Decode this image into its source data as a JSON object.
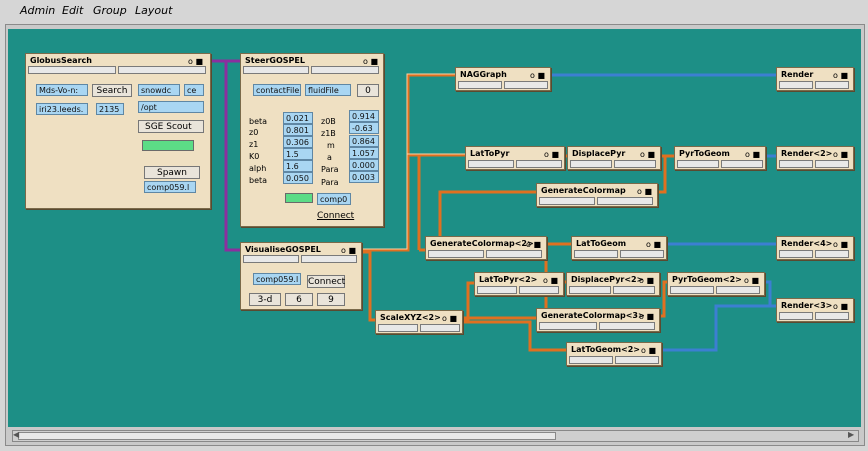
{
  "menu": [
    "Admin",
    "Edit",
    "Group",
    "Layout"
  ],
  "colors": {
    "canvas": "#1d8f86",
    "module": "#efe0c2",
    "orange": "#e07020",
    "blue": "#3c7fd2",
    "purple": "#8b2f9f",
    "green": "#5cdc86"
  },
  "modules": {
    "globus": {
      "title": "GlobusSearch",
      "ctrl": "o ■",
      "host1": "Mds-Vo-n:",
      "search": "Search",
      "host2": "iri23.leeds.",
      "port": "2135",
      "user": "snowdc",
      "ce": "ce",
      "path": "/opt",
      "scheduler": "SGE Scout",
      "spawn": "Spawn",
      "machine": "comp059.l"
    },
    "steer": {
      "title": "SteerGOSPEL",
      "ctrl": "o ■",
      "file1": "contactFile",
      "file2": "fluidFile",
      "count": "0",
      "left": [
        {
          "name": "beta",
          "value": "0.021"
        },
        {
          "name": "z0",
          "value": "0.801"
        },
        {
          "name": "z1",
          "value": "0.306"
        },
        {
          "name": "K0",
          "value": "1.5"
        },
        {
          "name": "alph",
          "value": "1.6"
        },
        {
          "name": "beta",
          "value": "0.050"
        }
      ],
      "right": [
        {
          "name": "z0B",
          "value": "0.914"
        },
        {
          "name": "z1B",
          "value": "-0.63"
        },
        {
          "name": "m",
          "value": "0.864"
        },
        {
          "name": "a",
          "value": "1.057"
        },
        {
          "name": "Para",
          "value": "0.000"
        },
        {
          "name": "Para",
          "value": "0.003"
        }
      ],
      "machine": "comp0",
      "connect": "Connect"
    },
    "vis": {
      "title": "VisualiseGOSPEL",
      "ctrl": "o ■",
      "machine": "comp059.l",
      "connect": "Connect",
      "mode": "3-d",
      "v1": "6",
      "v2": "9"
    },
    "nag": {
      "title": "NAGGraph",
      "ctrl": "o ■"
    },
    "render1": {
      "title": "Render",
      "ctrl": "o ■"
    },
    "lat1": {
      "title": "LatToPyr",
      "ctrl": "o ■"
    },
    "disp1": {
      "title": "DisplacePyr",
      "ctrl": "o ■"
    },
    "pyr1": {
      "title": "PyrToGeom",
      "ctrl": "o ■"
    },
    "render2": {
      "title": "Render<2>",
      "ctrl": "o ■"
    },
    "gencol": {
      "title": "GenerateColormap",
      "ctrl": "o ■"
    },
    "gencol2": {
      "title": "GenerateColormap<2>",
      "ctrl": "o ■"
    },
    "latgeom": {
      "title": "LatToGeom",
      "ctrl": "o ■"
    },
    "render4": {
      "title": "Render<4>",
      "ctrl": "o ■"
    },
    "lat2": {
      "title": "LatToPyr<2>",
      "ctrl": "o ■"
    },
    "disp2": {
      "title": "DisplacePyr<2>",
      "ctrl": "o ■"
    },
    "pyr2": {
      "title": "PyrToGeom<2>",
      "ctrl": "o ■"
    },
    "render3": {
      "title": "Render<3>",
      "ctrl": "o ■"
    },
    "scale": {
      "title": "ScaleXYZ<2>",
      "ctrl": "o ■"
    },
    "gencol3": {
      "title": "GenerateColormap<3>",
      "ctrl": "o ■"
    },
    "latgeom2": {
      "title": "LatToGeom<2>",
      "ctrl": "o ■"
    }
  }
}
